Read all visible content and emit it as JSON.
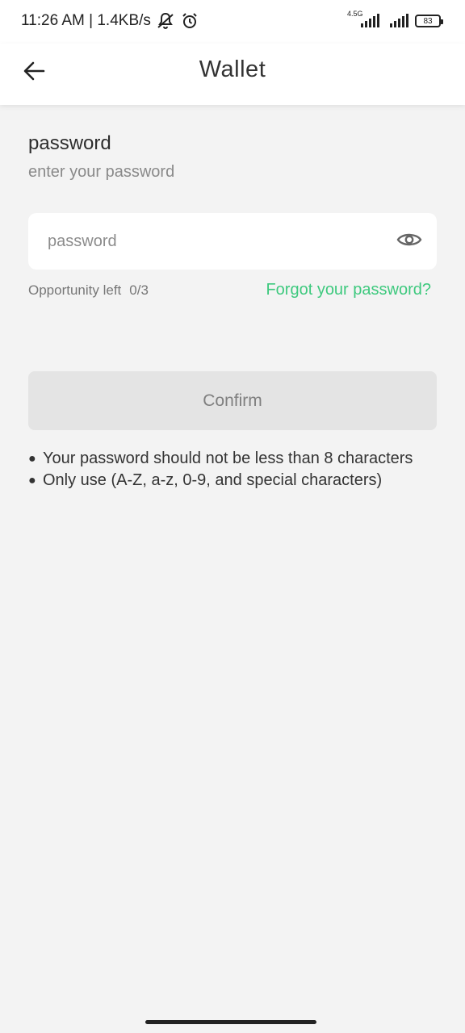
{
  "status_bar": {
    "time": "11:26 AM | 1.4KB/s",
    "network_label": "4.5G",
    "battery": "83",
    "icons": [
      "notifications-off-icon",
      "alarm-icon",
      "signal-icon",
      "signal-icon",
      "battery-icon"
    ]
  },
  "header": {
    "title": "Wallet",
    "back_icon": "arrow-left-icon"
  },
  "form": {
    "title": "password",
    "subtitle": "enter your password",
    "input_placeholder": "password",
    "input_value": "",
    "eye_icon": "eye-icon",
    "opportunity_label": "Opportunity left",
    "opportunity_count": "0/3",
    "forgot_label": "Forgot your password?",
    "confirm_label": "Confirm"
  },
  "rules": [
    "Your password should not be less than 8 characters",
    "Only use (A-Z, a-z, 0-9, and special characters)"
  ],
  "colors": {
    "accent": "#3ec97e",
    "background": "#f3f3f3",
    "button_disabled": "#e4e4e4"
  }
}
